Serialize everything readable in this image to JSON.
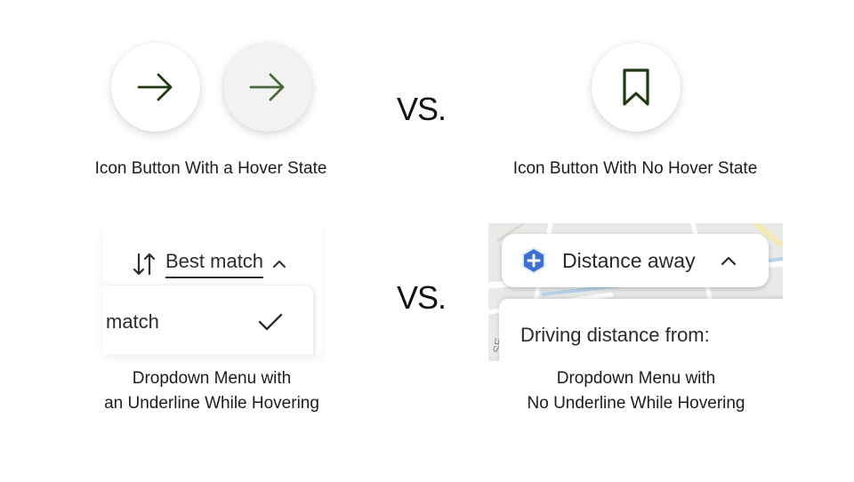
{
  "vs_labels": [
    "VS.",
    "VS."
  ],
  "icon_buttons": {
    "hover_example": {
      "caption": "Icon Button With a Hover State",
      "buttons": [
        {
          "icon": "arrow-right-icon",
          "state": "default",
          "color": "#1f3a14"
        },
        {
          "icon": "arrow-right-icon",
          "state": "hover",
          "color": "#4b6b3a"
        }
      ]
    },
    "no_hover_example": {
      "caption": "Icon Button With No Hover State",
      "buttons": [
        {
          "icon": "bookmark-icon",
          "state": "default",
          "color": "#1f3a14"
        }
      ]
    }
  },
  "dropdowns": {
    "underline_example": {
      "sort_icon": "sort-arrows-icon",
      "label": "Best match",
      "chevron_icon": "chevron-up-icon",
      "menu_item": "match",
      "menu_item_icon": "checkmark-icon",
      "caption_lines": [
        "Dropdown Menu with",
        "an Underline While Hovering"
      ]
    },
    "no_underline_example": {
      "badge_icon": "hexagon-plus-icon",
      "badge_color": "#3d6fd1",
      "label": "Distance away",
      "chevron_icon": "chevron-up-icon",
      "panel_text": "Driving distance from:",
      "caption_lines": [
        "Dropdown Menu with",
        "No Underline While Hovering"
      ]
    }
  }
}
